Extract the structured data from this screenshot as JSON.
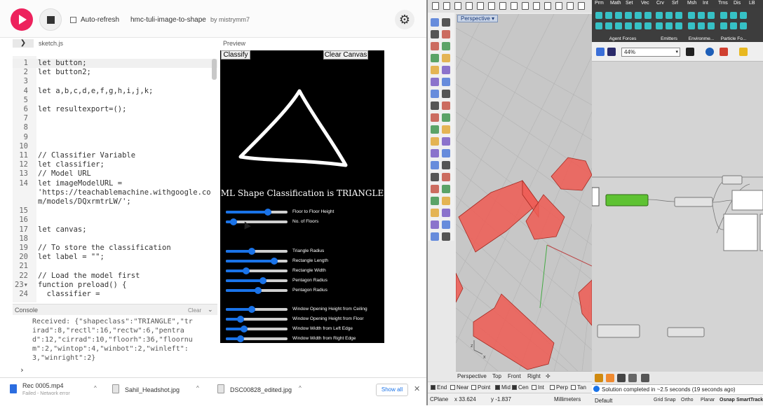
{
  "editor": {
    "autorefresh_label": "Auto-refresh",
    "sketch_title": "hmc-tuli-image-to-shape",
    "sketch_author": "by mistrymm7",
    "expand_glyph": "❯",
    "filename": "sketch.js",
    "preview_label": "Preview",
    "code_lines": [
      {
        "n": "1",
        "text": "let button;"
      },
      {
        "n": "2",
        "text": "let button2;"
      },
      {
        "n": "3",
        "text": ""
      },
      {
        "n": "4",
        "text": "let a,b,c,d,e,f,g,h,i,j,k;"
      },
      {
        "n": "5",
        "text": ""
      },
      {
        "n": "6",
        "text": "let resultexport=();"
      },
      {
        "n": "7",
        "text": ""
      },
      {
        "n": "8",
        "text": ""
      },
      {
        "n": "9",
        "text": ""
      },
      {
        "n": "10",
        "text": ""
      },
      {
        "n": "11",
        "text": "// Classifier Variable"
      },
      {
        "n": "12",
        "text": "let classifier;"
      },
      {
        "n": "13",
        "text": "// Model URL"
      },
      {
        "n": "14",
        "text": "let imageModelURL ="
      },
      {
        "n": "",
        "text": "'https://teachablemachine.withgoogle.co"
      },
      {
        "n": "",
        "text": "m/models/DQxrmtrLW/';"
      },
      {
        "n": "15",
        "text": ""
      },
      {
        "n": "16",
        "text": ""
      },
      {
        "n": "17",
        "text": "let canvas;"
      },
      {
        "n": "18",
        "text": ""
      },
      {
        "n": "19",
        "text": "// To store the classification"
      },
      {
        "n": "20",
        "text": "let label = \"\";"
      },
      {
        "n": "21",
        "text": ""
      },
      {
        "n": "22",
        "text": "// Load the model first"
      },
      {
        "n": "23▾",
        "text": "function preload() {"
      },
      {
        "n": "24",
        "text": "  classifier ="
      }
    ],
    "console_title": "Console",
    "console_clear": "Clear",
    "console_chevron": "⌄",
    "console_output": "Received: {\"shapeclass\":\"TRIANGLE\",\"tr\nirad\":8,\"rectl\":16,\"rectw\":6,\"pentra\nd\":12,\"cirrad\":10,\"floorh\":36,\"floornu\nm\":2,\"wintop\":4,\"winbot\":2,\"winleft\":\n3,\"winright\":2}",
    "console_prompt": "›",
    "settings_glyph": "⚙"
  },
  "preview": {
    "classify_label": "Classify",
    "clear_canvas_label": "Clear Canvas",
    "classification_text": "ML Shape Classification is TRIANGLE",
    "sliders": [
      {
        "label": "Floor to Floor Height",
        "value": 0.68
      },
      {
        "label": "No. of Floors",
        "value": 0.12
      },
      {
        "label": "Triangle Radius",
        "value": 0.42
      },
      {
        "label": "Rectangle Length",
        "value": 0.78
      },
      {
        "label": "Rectangle Width",
        "value": 0.33
      },
      {
        "label": "Pentagon Radius",
        "value": 0.6
      },
      {
        "label": "Pentagon Radius",
        "value": 0.52
      },
      {
        "label": "Window Opening Height from Ceiling",
        "value": 0.42
      },
      {
        "label": "Window Opening Height from Floor",
        "value": 0.24
      },
      {
        "label": "Window Width from Left Edge",
        "value": 0.3
      },
      {
        "label": "Window Width from Right Edge",
        "value": 0.24
      }
    ]
  },
  "downloads": [
    {
      "name": "Rec 0005.mp4",
      "status": "Failed - Network error",
      "type": "mp4"
    },
    {
      "name": "Sahil_Headshot.jpg",
      "status": "",
      "type": "jpg"
    },
    {
      "name": "DSC00828_edited.jpg",
      "status": "",
      "type": "jpg"
    }
  ],
  "downloads_show_all": "Show all",
  "downloads_close": "✕",
  "dl_chevron": "^",
  "rhino": {
    "viewport_name": "Perspective",
    "viewport_tabs": [
      "Perspective",
      "Top",
      "Front",
      "Right",
      "✢"
    ],
    "osnaps": [
      {
        "label": "End",
        "on": true
      },
      {
        "label": "Near",
        "on": false
      },
      {
        "label": "Point",
        "on": false
      },
      {
        "label": "Mid",
        "on": true
      },
      {
        "label": "Cen",
        "on": true
      },
      {
        "label": "Int",
        "on": false
      },
      {
        "label": "Perp",
        "on": false
      },
      {
        "label": "Tan",
        "on": false
      }
    ],
    "cplane": "CPlane",
    "coord_x": "x 33.624",
    "coord_y": "y -1.837",
    "units": "Millimeters",
    "layer": "Default",
    "status_right": [
      "Grid Snap",
      "Ortho",
      "Planar",
      "Osnap",
      "SmartTrack"
    ],
    "axis_z": "z",
    "axis_x": "x",
    "volume_color": "#f0504a"
  },
  "gh": {
    "tabs": [
      "Prm",
      "Math",
      "Set",
      "Vec",
      "Crv",
      "Srf",
      "Msh",
      "Int",
      "Trns",
      "Dis",
      "LB"
    ],
    "groups": [
      "Agent Forces",
      "Emitters",
      "Environme...",
      "Particle Fo..."
    ],
    "zoom": "44%",
    "solution_text": "Solution completed in ~2.5 seconds (19 seconds ago)",
    "accent": "#36c1c5",
    "component_color": "#5ec232"
  }
}
